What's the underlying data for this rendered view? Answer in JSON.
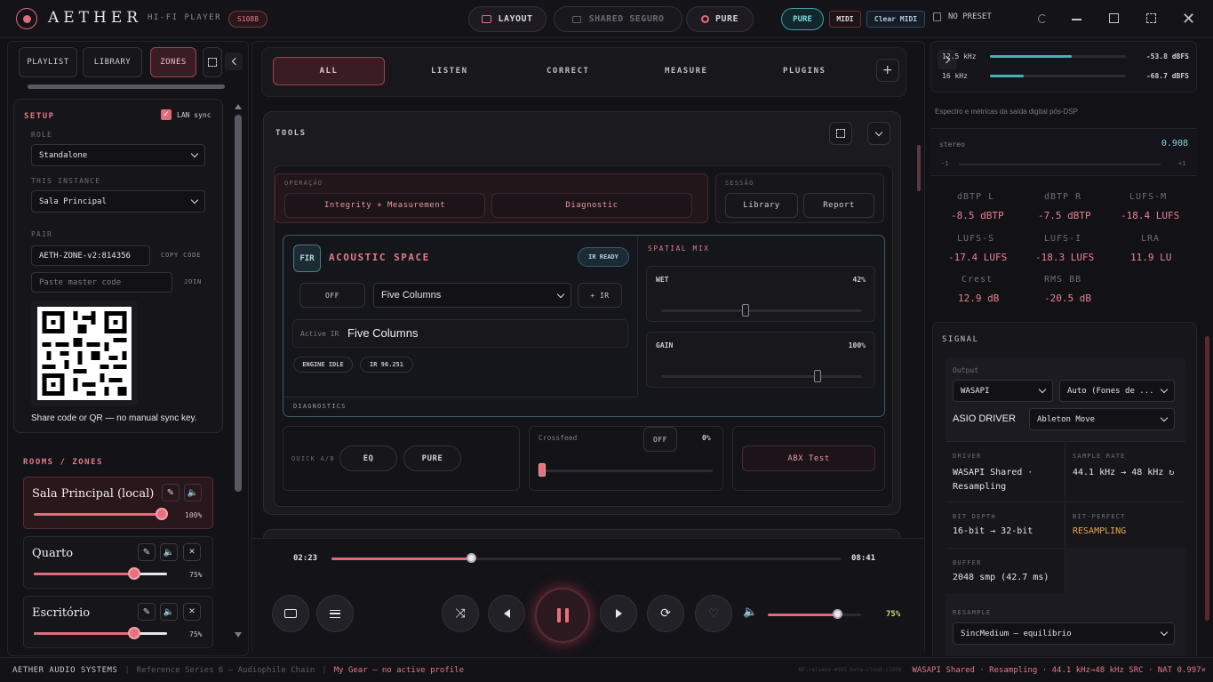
{
  "topbar": {
    "app_name": "AETHER",
    "subtitle": "HI-FI PLAYER",
    "device_badge": "S1088",
    "layout_label": "LAYOUT",
    "shared_label": "SHARED SEGURO",
    "pure_label": "PURE",
    "pure_chip": "PURE",
    "midi_chip": "MIDI",
    "clear_midi": "Clear MIDI",
    "preset_label": "NO PRESET"
  },
  "left": {
    "tabs": [
      "PLAYLIST",
      "LIBRARY",
      "ZONES"
    ],
    "setup": {
      "title": "SETUP",
      "lan_sync_label": "LAN sync",
      "role_label": "ROLE",
      "role_value": "Standalone",
      "instance_label": "THIS INSTANCE",
      "instance_value": "Sala Principal",
      "pair_label": "PAIR",
      "pair_code": "AETH-ZONE-v2:814356",
      "copy_code": "COPY CODE",
      "master_placeholder": "Paste master code",
      "join_label": "JOIN",
      "share_note": "Share code or QR — no manual sync key."
    },
    "rooms_title": "ROOMS / ZONES",
    "rooms": [
      {
        "name": "Sala Principal (local)",
        "volume_pct": "100%",
        "volume": 1.0
      },
      {
        "name": "Quarto",
        "volume_pct": "75%",
        "volume": 0.75
      },
      {
        "name": "Escritório",
        "volume_pct": "75%",
        "volume": 0.75
      }
    ]
  },
  "center": {
    "tabs": [
      "ALL",
      "LISTEN",
      "CORRECT",
      "MEASURE",
      "PLUGINS"
    ],
    "tools_title": "TOOLS",
    "operacao_label": "OPERAÇÃO",
    "integrity_btn": "Integrity + Measurement",
    "diagnostic_btn": "Diagnostic",
    "sessao_label": "SESSÃO",
    "library_btn": "Library",
    "report_btn": "Report",
    "acoustic": {
      "fir_badge": "FIR",
      "title": "ACOUSTIC SPACE",
      "ir_ready": "IR READY",
      "off_btn": "OFF",
      "room_select": "Five Columns",
      "add_ir": "+ IR",
      "active_ir_label": "Active IR",
      "active_ir_value": "Five Columns",
      "engine_idle": "ENGINE IDLE",
      "ir_code": "IR 96.251",
      "diagnostics_label": "DIAGNOSTICS"
    },
    "spatial": {
      "title": "SPATIAL MIX",
      "wet_label": "WET",
      "wet_value": "42%",
      "wet": 0.42,
      "gain_label": "GAIN",
      "gain_value": "100%",
      "gain": 1.0
    },
    "quick_ab_label": "QUICK A/B",
    "eq_btn": "EQ",
    "pure_btn": "PURE",
    "crossfeed_label": "Crossfeed",
    "crossfeed_off": "OFF",
    "crossfeed_value": "0%",
    "abx_btn": "ABX Test"
  },
  "transport": {
    "elapsed": "02:23",
    "total": "08:41",
    "progress": 0.274,
    "volume_value": "75%",
    "volume": 0.75
  },
  "right": {
    "bands": [
      {
        "label": "12.5 kHz",
        "value": "-53.8 dBFS",
        "level": 0.6
      },
      {
        "label": "16 kHz",
        "value": "-68.7 dBFS",
        "level": 0.25
      }
    ],
    "spectrum_note": "Espectro e métricas da saída digital pós-DSP",
    "stereo_label": "stereo",
    "stereo_value": "0.908",
    "stereo_min": "-1",
    "stereo_max": "+1",
    "metrics": [
      {
        "label": "dBTP L",
        "value": "-8.5 dBTP"
      },
      {
        "label": "dBTP R",
        "value": "-7.5 dBTP"
      },
      {
        "label": "LUFS-M",
        "value": "-18.4 LUFS"
      },
      {
        "label": "LUFS-S",
        "value": "-17.4 LUFS"
      },
      {
        "label": "LUFS-I",
        "value": "-18.3 LUFS"
      },
      {
        "label": "LRA",
        "value": "11.9 LU"
      },
      {
        "label": "Crest",
        "value": "12.9 dB"
      },
      {
        "label": "RMS BB",
        "value": "-20.5 dB"
      }
    ],
    "signal": {
      "title": "SIGNAL",
      "output_label": "Output",
      "output_value": "WASAPI",
      "device_value": "Auto (Fones de ...",
      "asio_label": "ASIO DRIVER",
      "asio_value": "Ableton Move",
      "driver_label": "DRIVER",
      "driver_value": "WASAPI Shared · Resampling",
      "rate_label": "SAMPLE RATE",
      "rate_value": "44.1 kHz → 48 kHz ↻",
      "depth_label": "BIT DEPTH",
      "depth_value": "16-bit → 32-bit",
      "perfect_label": "BIT-PERFECT",
      "perfect_value": "RESAMPLING",
      "buffer_label": "BUFFER",
      "buffer_value": "2048 smp (42.7 ms)",
      "resample_label": "RESAMPLE",
      "resample_value": "SincMedium — equilíbrio"
    }
  },
  "status": {
    "brand": "AETHER AUDIO SYSTEMS",
    "series": "Reference Series 6 — Audiophile Chain",
    "gear": "My Gear — no active profile",
    "build": "NF-release-#985 beta-cloud-c1008",
    "chain": "WASAPI Shared · Resampling · 44.1 kHz→48 kHz SRC · NAT 0.997×"
  }
}
